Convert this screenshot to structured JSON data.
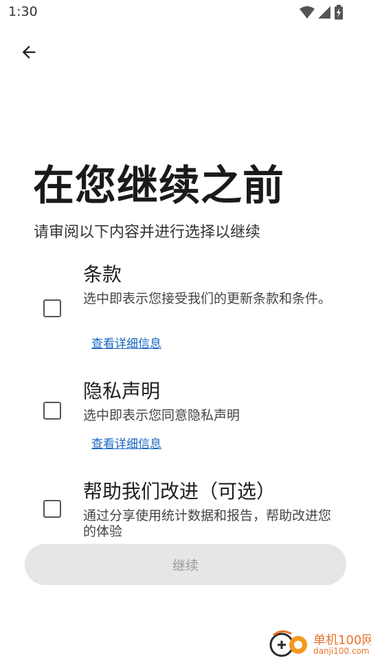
{
  "status_bar": {
    "time": "1:30",
    "icons": [
      "wifi-icon",
      "signal-icon",
      "battery-charging-icon"
    ]
  },
  "header": {
    "back_icon": "arrow-back-icon"
  },
  "main": {
    "title": "在您继续之前",
    "subtitle": "请审阅以下内容并进行选择以继续",
    "sections": [
      {
        "title": "条款",
        "description": "选中即表示您接受我们的更新条款和条件。",
        "link": "查看详细信息",
        "checked": false
      },
      {
        "title": "隐私声明",
        "description": "选中即表示您同意隐私声明",
        "link": "查看详细信息",
        "checked": false
      },
      {
        "title": "帮助我们改进（可选）",
        "description": "通过分享使用统计数据和报告，帮助改进您的体验",
        "checked": false
      }
    ]
  },
  "footer": {
    "continue_label": "继续"
  },
  "watermark": {
    "name": "单机100网",
    "url": "danji100.com"
  },
  "colors": {
    "link": "#1565c0",
    "button_bg": "#e6e6e6",
    "button_text": "#9a9a9a",
    "watermark": "#e8742c"
  }
}
